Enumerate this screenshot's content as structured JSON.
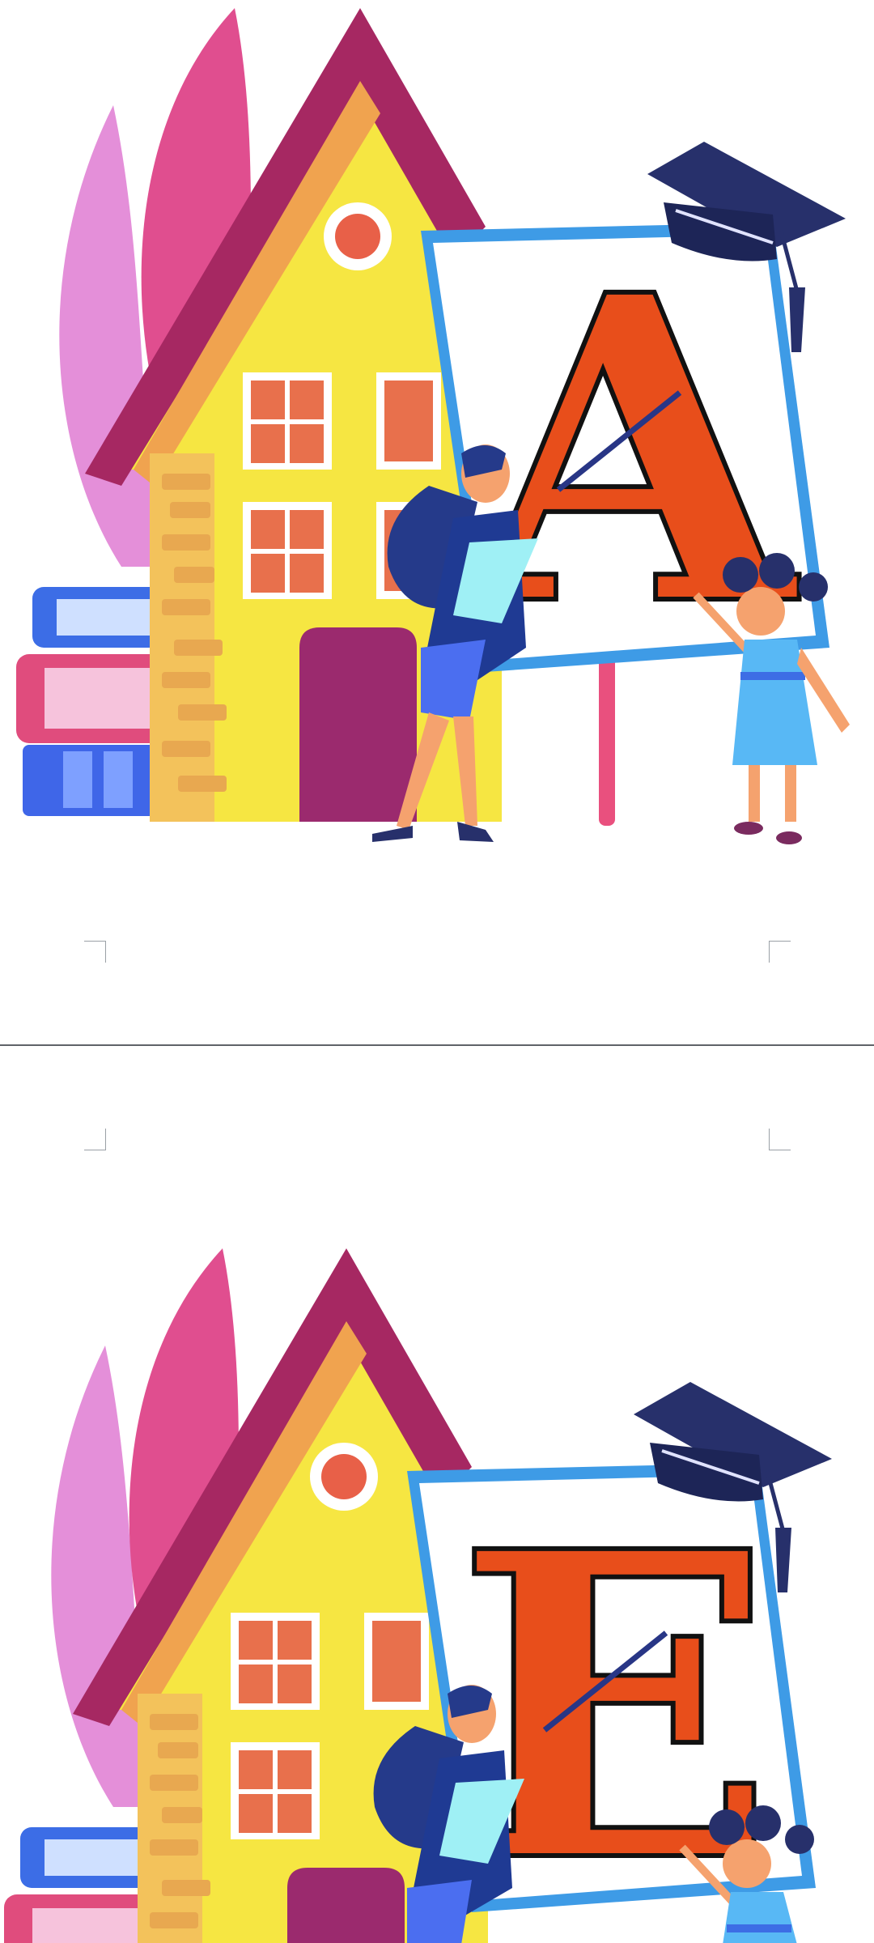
{
  "document": {
    "pages": [
      {
        "letter": "A"
      },
      {
        "letter": "E"
      }
    ]
  },
  "colors": {
    "letter_fill": "#e84e1b",
    "board_frame": "#3e9be6",
    "roof": "#a62862",
    "house_wall": "#f6e642",
    "door": "#9b2a6e",
    "cap": "#27306b",
    "leaves": "#d9579b",
    "page_break": "#5f6368"
  },
  "icons": [
    "school-house-illustration",
    "graduation-cap-icon",
    "teacher-figure",
    "student-figure",
    "books-stack"
  ]
}
